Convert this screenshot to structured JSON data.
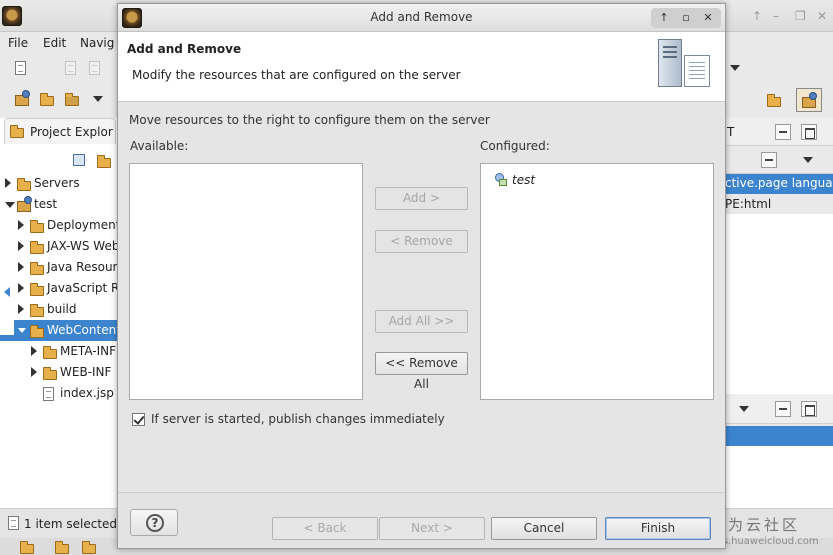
{
  "background_window": {
    "menu": [
      "File",
      "Edit",
      "Navig"
    ],
    "project_explorer": {
      "tab_label": "Project Explor",
      "tree": [
        {
          "label": "Servers",
          "expander": "collapsed",
          "icon": "folder-icon"
        },
        {
          "label": "test",
          "expander": "expanded",
          "icon": "project-icon"
        },
        {
          "label": "Deployment",
          "expander": "collapsed",
          "icon": "deployment-icon"
        },
        {
          "label": "JAX-WS Web",
          "expander": "collapsed",
          "icon": "webservice-icon"
        },
        {
          "label": "Java Resour",
          "expander": "collapsed",
          "icon": "java-resources-icon"
        },
        {
          "label": "JavaScript R",
          "expander": "collapsed",
          "icon": "javascript-icon"
        },
        {
          "label": "build",
          "expander": "collapsed",
          "icon": "folder-icon"
        },
        {
          "label": "WebContent",
          "expander": "expanded",
          "icon": "folder-icon",
          "selected": true
        },
        {
          "label": "META-INF",
          "expander": "collapsed",
          "icon": "folder-icon"
        },
        {
          "label": "WEB-INF",
          "expander": "collapsed",
          "icon": "folder-icon"
        },
        {
          "label": "index.jsp",
          "expander": "none",
          "icon": "jsp-file-icon"
        }
      ]
    },
    "editor_fragments": [
      "ctive.page languag",
      "PE:html"
    ],
    "right_tab_letter": "T",
    "status_text": "1 item selected"
  },
  "dialog": {
    "title": "Add and Remove",
    "banner_title": "Add and Remove",
    "banner_subtitle": "Modify the resources that are configured on the server",
    "instructions": "Move resources to the right to configure them on the server",
    "available_label": "Available:",
    "configured_label": "Configured:",
    "available_items": [],
    "configured_items": [
      "test"
    ],
    "buttons": {
      "add": "Add >",
      "remove": "< Remove",
      "add_all": "Add All >>",
      "remove_all": "<< Remove All"
    },
    "publish_checkbox": {
      "label": "If server is started, publish changes immediately",
      "checked": true
    },
    "footer": {
      "help": "?",
      "back": "< Back",
      "next": "Next >",
      "cancel": "Cancel",
      "finish": "Finish"
    }
  },
  "watermark": {
    "cn": "华为云社区",
    "url": "bbs.huaweicloud.com"
  },
  "colors": {
    "selection": "#3d84cf",
    "dialog_bg": "#e5e5e5",
    "banner_bg": "#ffffff"
  }
}
